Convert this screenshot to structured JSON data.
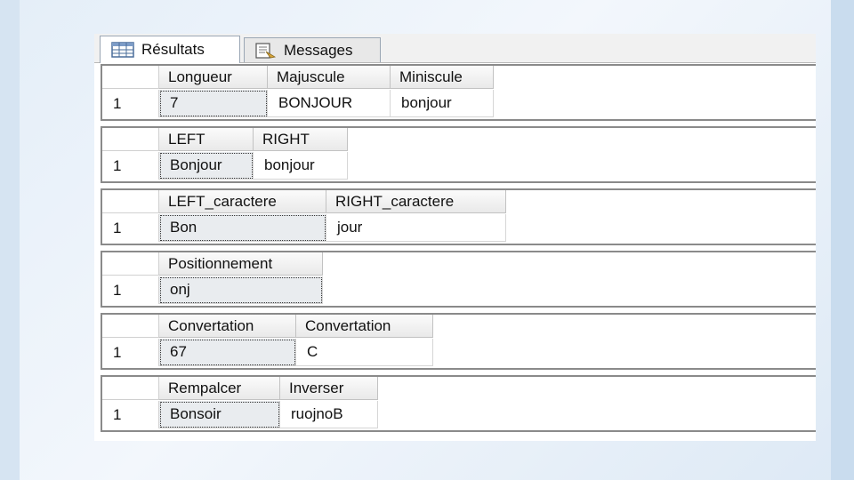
{
  "tabs": [
    {
      "label": "Résultats",
      "icon": "grid-icon",
      "active": true
    },
    {
      "label": "Messages",
      "icon": "messages-icon",
      "active": false
    }
  ],
  "grids": [
    {
      "row_number": "1",
      "headers": [
        "Longueur",
        "Majuscule",
        "Miniscule"
      ],
      "values": [
        "7",
        "BONJOUR",
        "bonjour"
      ]
    },
    {
      "row_number": "1",
      "headers": [
        "LEFT",
        "RIGHT"
      ],
      "values": [
        "Bonjour",
        "bonjour"
      ]
    },
    {
      "row_number": "1",
      "headers": [
        "LEFT_caractere",
        "RIGHT_caractere"
      ],
      "values": [
        "Bon",
        "jour"
      ]
    },
    {
      "row_number": "1",
      "headers": [
        "Positionnement"
      ],
      "values": [
        "onj"
      ]
    },
    {
      "row_number": "1",
      "headers": [
        "Convertation",
        "Convertation"
      ],
      "values": [
        "67",
        "C"
      ]
    },
    {
      "row_number": "1",
      "headers": [
        "Rempalcer",
        "Inverser"
      ],
      "values": [
        "Bonsoir",
        "ruojnoB"
      ]
    }
  ]
}
